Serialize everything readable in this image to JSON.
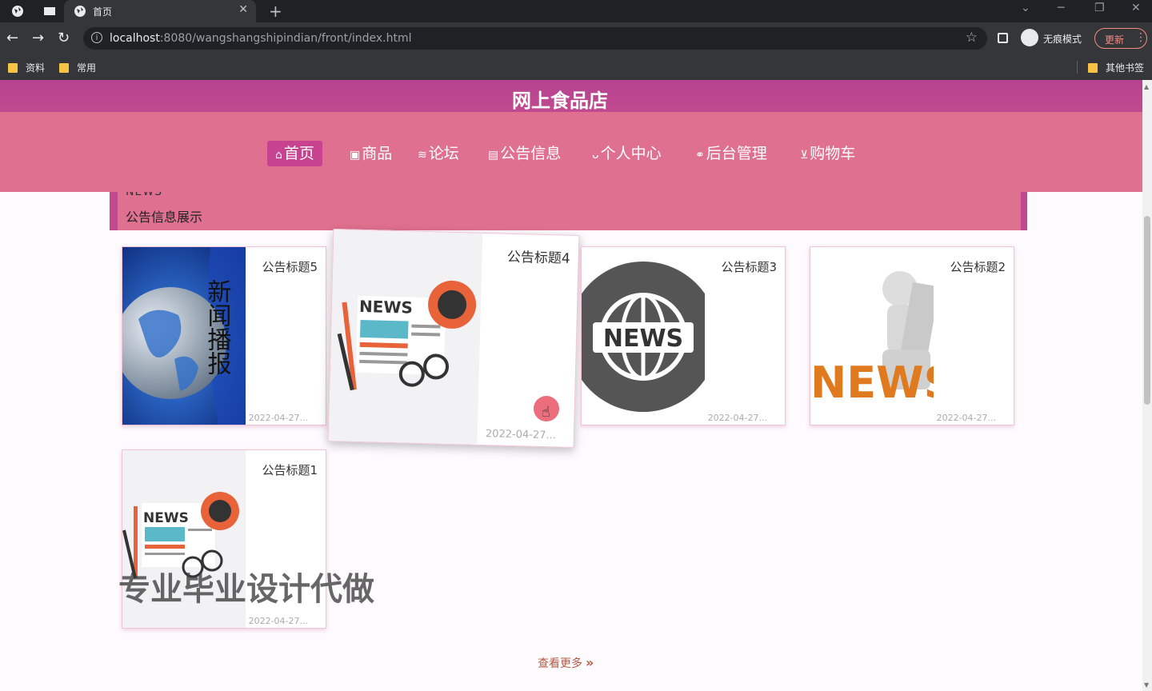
{
  "browser": {
    "tab_title": "首页",
    "tab_close": "✕",
    "new_tab": "+",
    "url_host": "localhost",
    "url_rest": ":8080/wangshangshipindian/front/index.html",
    "profile_label": "无痕模式",
    "update_label": "更新",
    "bookmarks": [
      "资料",
      "常用"
    ],
    "other_bookmarks": "其他书签"
  },
  "site": {
    "title": "网上食品店",
    "nav": [
      {
        "label": "首页",
        "icon": "⌂"
      },
      {
        "label": "商品",
        "icon": "▣"
      },
      {
        "label": "论坛",
        "icon": "≋"
      },
      {
        "label": "公告信息",
        "icon": "▤"
      },
      {
        "label": "个人中心",
        "icon": "ᴗ"
      },
      {
        "label": "后台管理",
        "icon": "⚭"
      },
      {
        "label": "购物车",
        "icon": "⊻"
      }
    ]
  },
  "section": {
    "en": "NEWS",
    "cn": "公告信息展示"
  },
  "cards": [
    {
      "title": "公告标题5",
      "date": "2022-04-27...",
      "image": "globe-news"
    },
    {
      "title": "公告标题4",
      "date": "2022-04-27...",
      "image": "newspaper-flat"
    },
    {
      "title": "公告标题3",
      "date": "2022-04-27...",
      "image": "news-globe-circle"
    },
    {
      "title": "公告标题2",
      "date": "2022-04-27...",
      "image": "figure-reading-news"
    },
    {
      "title": "公告标题1",
      "date": "2022-04-27...",
      "image": "newspaper-flat"
    }
  ],
  "card_image_text": {
    "news": "NEWS",
    "vertical": "新闻播报"
  },
  "more_label": "查看更多",
  "more_icon": "»",
  "watermark": "专业毕业设计代做",
  "colors": {
    "title_bar": "#b5438f",
    "nav_bg": "#e0708f",
    "nav_active": "#c74390",
    "more_text": "#b45a47"
  }
}
